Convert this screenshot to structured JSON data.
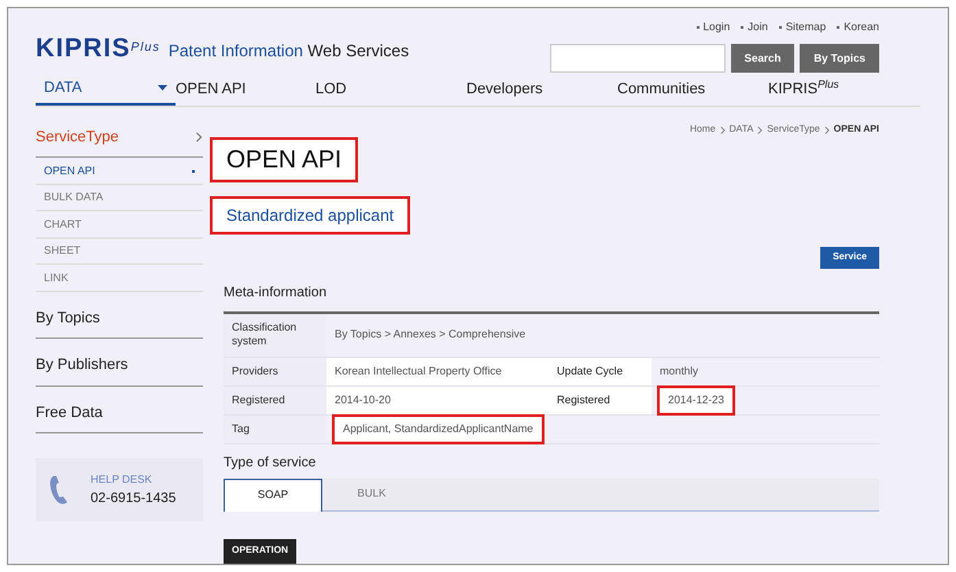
{
  "header": {
    "logo": {
      "name": "KIPRIS",
      "sup": "Plus"
    },
    "tagline": {
      "part_1": "Patent Information",
      "part_2": "Web Services"
    },
    "util_links": [
      "Login",
      "Join",
      "Sitemap",
      "Korean"
    ],
    "search": {
      "button": "Search"
    },
    "topics_button": "By Topics"
  },
  "nav": [
    {
      "label": "DATA",
      "selected": true,
      "dropdown": true
    },
    {
      "label": "OPEN API",
      "selected": false,
      "dropdown": false
    },
    {
      "label": "LOD",
      "selected": false,
      "dropdown": false
    },
    {
      "label": "Developers",
      "selected": false,
      "dropdown": false
    },
    {
      "label": "Communities",
      "selected": false,
      "dropdown": false
    },
    {
      "label": "KIPRIS",
      "sup": "Plus",
      "selected": false,
      "dropdown": false
    }
  ],
  "sidebar": {
    "section": "ServiceType",
    "items": [
      {
        "label": "OPEN API",
        "selected": true
      },
      {
        "label": "BULK DATA",
        "selected": false
      },
      {
        "label": "CHART",
        "selected": false
      },
      {
        "label": "SHEET",
        "selected": false
      },
      {
        "label": "LINK",
        "selected": false
      }
    ],
    "groups": [
      "By Topics",
      "By Publishers",
      "Free Data"
    ],
    "helpdesk": {
      "title": "HELP DESK",
      "phone": "02-6915-1435"
    }
  },
  "breadcrumb": [
    "Home",
    "DATA",
    "ServiceType",
    "OPEN API"
  ],
  "title": {
    "text": "OPEN API",
    "highlighted": true
  },
  "subtitle": {
    "text": "Standardized applicant",
    "highlighted": true
  },
  "service_button": "Service",
  "meta_heading": "Meta-information",
  "table": {
    "rows": [
      {
        "cells": [
          {
            "kind": "label",
            "text": "Classification system",
            "highlighted": false
          },
          {
            "kind": "value",
            "text": "By Topics > Annexes > Comprehensive",
            "highlighted": false
          }
        ]
      },
      {
        "cells": [
          {
            "kind": "label",
            "text": "Providers",
            "highlighted": false
          },
          {
            "kind": "value",
            "text": "Korean Intellectual Property Office",
            "highlighted": false
          },
          {
            "kind": "label",
            "text": "Update Cycle",
            "highlighted": false
          },
          {
            "kind": "value",
            "text": "monthly",
            "highlighted": false
          }
        ]
      },
      {
        "cells": [
          {
            "kind": "label",
            "text": "Registered",
            "highlighted": false
          },
          {
            "kind": "value",
            "text": "2014-10-20",
            "highlighted": false
          },
          {
            "kind": "label",
            "text": "Registered",
            "highlighted": false
          },
          {
            "kind": "value",
            "text": "2014-12-23",
            "highlighted": true
          }
        ]
      },
      {
        "cells": [
          {
            "kind": "label",
            "text": "Tag",
            "highlighted": false
          },
          {
            "kind": "value",
            "text": "Applicant, StandardizedApplicantName",
            "highlighted": true
          }
        ]
      }
    ]
  },
  "service_type": {
    "heading": "Type of service",
    "tabs": [
      {
        "label": "SOAP",
        "selected": true
      },
      {
        "label": "BULK",
        "selected": false
      }
    ]
  },
  "operation_button": "OPERATION"
}
